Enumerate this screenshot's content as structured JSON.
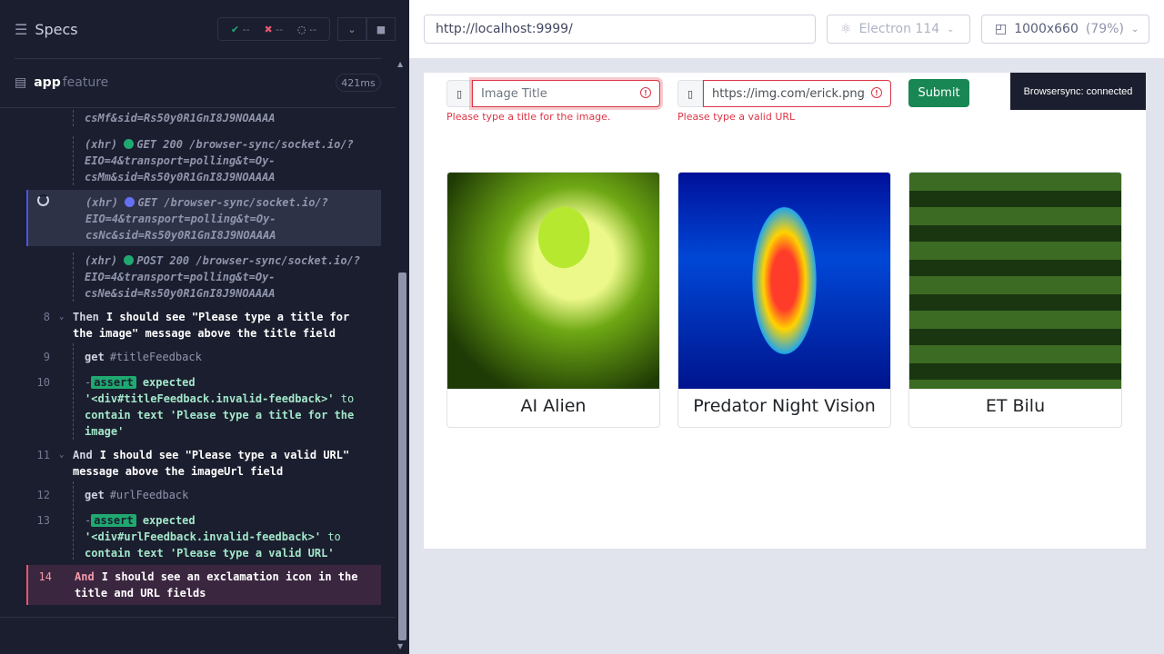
{
  "specs_bar": {
    "title": "Specs",
    "passed": "--",
    "failed": "--",
    "pending": "--"
  },
  "file": {
    "name": "app",
    "suffix": "feature",
    "duration": "421ms"
  },
  "log": {
    "xhr1_tail": "csMf&sid=Rs50y0R1GnI8J9NOAAAA",
    "xhr2": {
      "type": "(xhr)",
      "text": "GET 200 /browser-sync/socket.io/?",
      "l2": "EIO=4&transport=polling&t=Oy-",
      "l3": "csMm&sid=Rs50y0R1GnI8J9NOAAAA"
    },
    "xhr3": {
      "type": "(xhr)",
      "text": "GET /browser-sync/socket.io/?",
      "l2": "EIO=4&transport=polling&t=Oy-",
      "l3": "csNc&sid=Rs50y0R1GnI8J9NOAAAA"
    },
    "xhr4": {
      "type": "(xhr)",
      "text": "POST 200 /browser-sync/socket.io/?",
      "l2": "EIO=4&transport=polling&t=Oy-",
      "l3": "csNe&sid=Rs50y0R1GnI8J9NOAAAA"
    },
    "s8": {
      "num": "8",
      "kw": "Then",
      "text": "I should see \"Please type a title for",
      "text2": "the image\" message above the title field"
    },
    "s9": {
      "num": "9",
      "cmd": "get",
      "sel": "#titleFeedback"
    },
    "s10": {
      "num": "10",
      "badge": "assert",
      "l1": "expected",
      "l2": "'<div#titleFeedback.invalid-feedback>'",
      "to": "to",
      "l3a": "contain text",
      "l3b": "'Please type a title for the",
      "l4": "image'"
    },
    "s11": {
      "num": "11",
      "kw": "And",
      "text": "I should see \"Please type a valid URL\"",
      "text2": "message above the imageUrl field"
    },
    "s12": {
      "num": "12",
      "cmd": "get",
      "sel": "#urlFeedback"
    },
    "s13": {
      "num": "13",
      "badge": "assert",
      "l1": "expected",
      "l2": "'<div#urlFeedback.invalid-feedback>'",
      "to": "to",
      "l3a": "contain text",
      "l3b": "'Please type a valid URL'"
    },
    "s14": {
      "num": "14",
      "kw": "And",
      "text": "I should see an exclamation icon in the",
      "text2": "title and URL fields"
    }
  },
  "browser_bar": {
    "url": "http://localhost:9999/",
    "browser": "Electron 114",
    "viewport": "1000x660",
    "zoom": "(79%)"
  },
  "app": {
    "title_placeholder": "Image Title",
    "url_value": "https://img.com/erick.png",
    "title_feedback": "Please type a title for the image.",
    "url_feedback": "Please type a valid URL",
    "submit": "Submit",
    "browsersync": "Browsersync: connected",
    "cards": [
      {
        "caption": "AI Alien"
      },
      {
        "caption": "Predator Night Vision"
      },
      {
        "caption": "ET Bilu"
      }
    ]
  }
}
